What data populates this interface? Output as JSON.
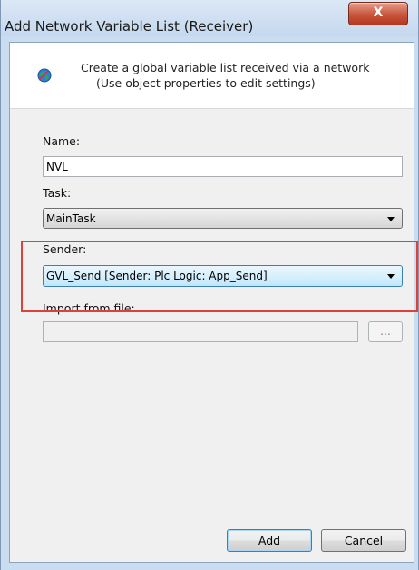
{
  "window": {
    "title": "Add Network Variable List (Receiver)",
    "close_glyph": "X"
  },
  "header": {
    "icon": "globe-icon",
    "description_line1": "Create a global variable list received via a network",
    "description_line2": "(Use object properties to edit settings)"
  },
  "form": {
    "name_label": "Name:",
    "name_value": "NVL",
    "task_label": "Task:",
    "task_value": "MainTask",
    "sender_label": "Sender:",
    "sender_value": "GVL_Send [Sender: Plc Logic: App_Send]",
    "import_label": "Import from file:",
    "import_value": "",
    "browse_label": "..."
  },
  "buttons": {
    "add": "Add",
    "cancel": "Cancel"
  },
  "colors": {
    "highlight_border": "#e0403a",
    "close_button": "#c8553c"
  }
}
